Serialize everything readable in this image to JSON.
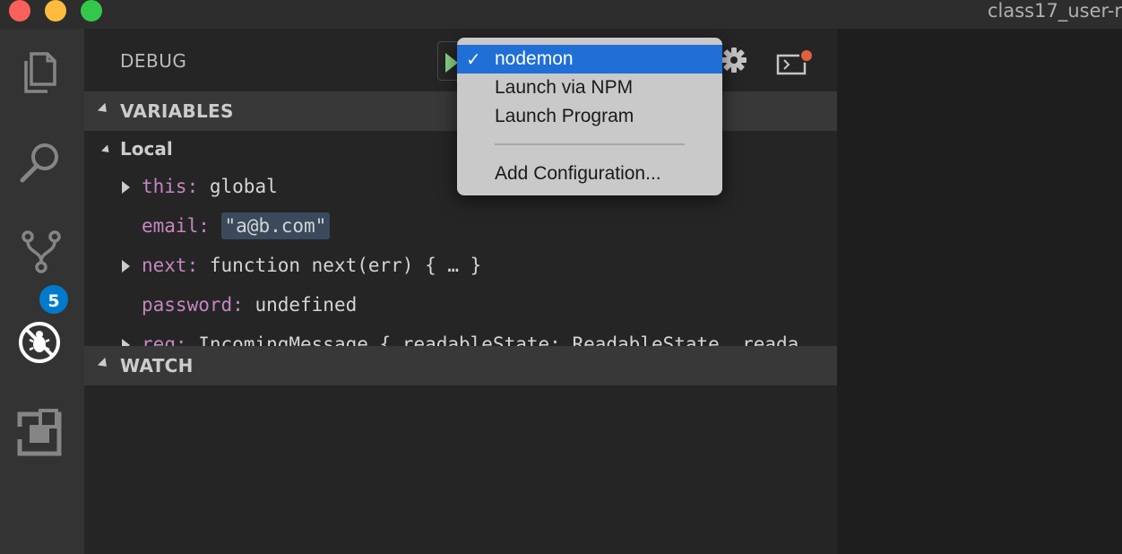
{
  "window": {
    "title": "class17_user-r"
  },
  "activity_bar": {
    "icons": [
      "files-icon",
      "search-icon",
      "source-control-icon",
      "debug-icon",
      "extensions-icon"
    ],
    "scm_badge": "5"
  },
  "debug": {
    "header_title": "DEBUG",
    "config_menu": {
      "items": [
        {
          "label": "nodemon",
          "selected": true
        },
        {
          "label": "Launch via NPM",
          "selected": false
        },
        {
          "label": "Launch Program",
          "selected": false
        }
      ],
      "add_label": "Add Configuration..."
    },
    "variables": {
      "section_title": "VARIABLES",
      "scope_label": "Local",
      "rows": [
        {
          "name": "this:",
          "value": "global"
        },
        {
          "name": "email:",
          "value": "\"a@b.com\""
        },
        {
          "name": "next:",
          "value": "function next(err) { … }"
        },
        {
          "name": "password:",
          "value": "undefined"
        },
        {
          "name": "req:",
          "value": "IncomingMessage { readableState: ReadableState, reada"
        }
      ]
    },
    "watch": {
      "section_title": "WATCH"
    }
  },
  "colors": {
    "accent": "#007acc",
    "menu_highlight": "#1f6fd6",
    "variable_name": "#c586c0",
    "run_green": "#89d185",
    "notification_dot": "#e0623a"
  }
}
